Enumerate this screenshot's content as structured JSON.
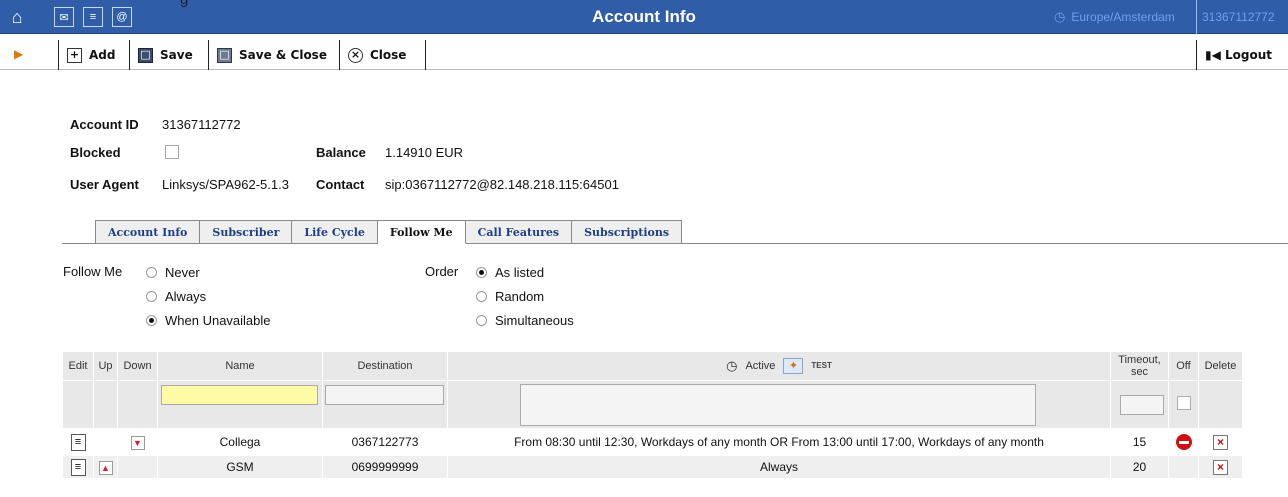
{
  "topbar": {
    "crop_text": "g",
    "title": "Account Info",
    "timezone": "Europe/Amsterdam",
    "account": "31367112772"
  },
  "toolbar": {
    "add": "Add",
    "save": "Save",
    "save_close": "Save & Close",
    "close": "Close",
    "logout": "Logout"
  },
  "account": {
    "id_label": "Account ID",
    "id": "31367112772",
    "blocked_label": "Blocked",
    "blocked": false,
    "balance_label": "Balance",
    "balance": "1.14910 EUR",
    "ua_label": "User Agent",
    "ua": "Linksys/SPA962-5.1.3",
    "contact_label": "Contact",
    "contact": "sip:0367112772@82.148.218.115:64501"
  },
  "tabs": [
    "Account Info",
    "Subscriber",
    "Life Cycle",
    "Follow Me",
    "Call Features",
    "Subscriptions"
  ],
  "active_tab": "Follow Me",
  "follow_me": {
    "label": "Follow Me",
    "options": [
      "Never",
      "Always",
      "When Unavailable"
    ],
    "selected": "When Unavailable"
  },
  "order": {
    "label": "Order",
    "options": [
      "As listed",
      "Random",
      "Simultaneous"
    ],
    "selected": "As listed"
  },
  "table": {
    "headers": {
      "edit": "Edit",
      "up": "Up",
      "down": "Down",
      "name": "Name",
      "destination": "Destination",
      "active": "Active",
      "timeout": "Timeout, sec",
      "off": "Off",
      "delete": "Delete"
    },
    "test_icon_text": "TEST",
    "rows": [
      {
        "name": "Collega",
        "destination": "0367122773",
        "active": "From 08:30 until 12:30, Workdays of any month OR From 13:00 until 17:00, Workdays of any month",
        "timeout": "15",
        "off": true
      },
      {
        "name": "GSM",
        "destination": "0699999999",
        "active": "Always",
        "timeout": "20",
        "off": false
      }
    ]
  }
}
